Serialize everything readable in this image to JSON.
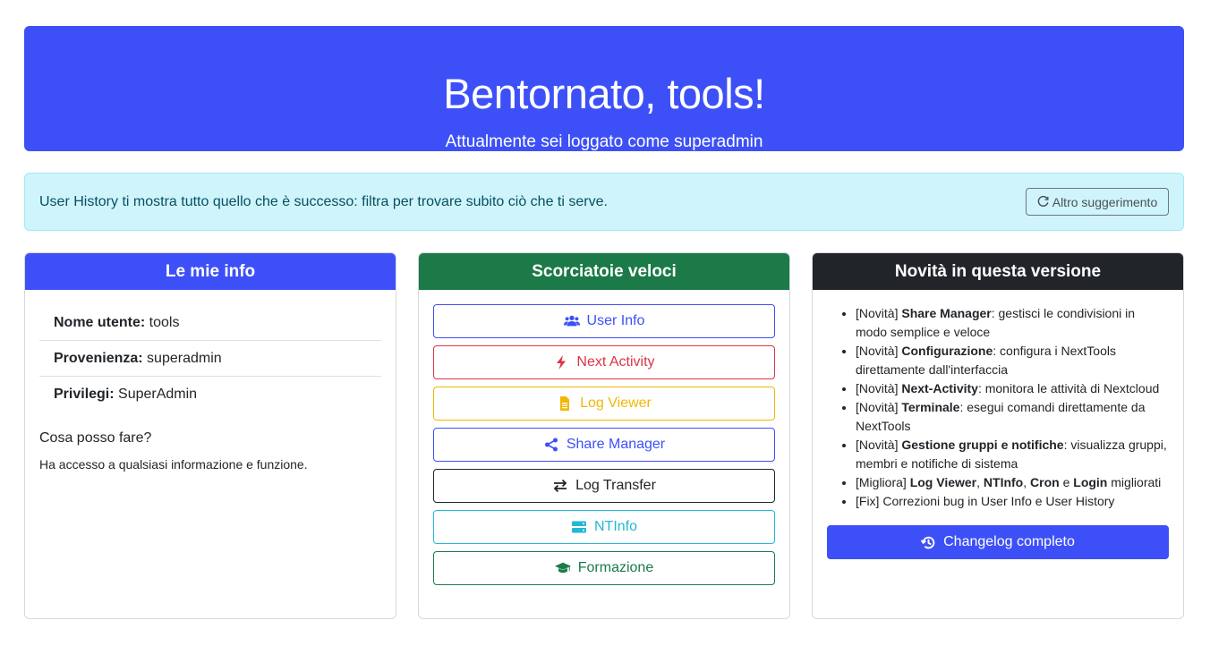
{
  "hero": {
    "title": "Bentornato, tools!",
    "subtitle_prefix": "Attualmente sei loggato come ",
    "subtitle_role": "superadmin"
  },
  "tip": {
    "text": "User History ti mostra tutto quello che è successo: filtra per trovare subito ciò che ti serve.",
    "button_label": "Altro suggerimento"
  },
  "info_card": {
    "title": "Le mie info",
    "rows": [
      {
        "label": "Nome utente:",
        "value": " tools"
      },
      {
        "label": "Provenienza:",
        "value": " superadmin"
      },
      {
        "label": "Privilegi:",
        "value": " SuperAdmin"
      }
    ],
    "can_title": "Cosa posso fare?",
    "can_text": "Ha accesso a qualsiasi informazione e funzione."
  },
  "shortcuts_card": {
    "title": "Scorciatoie veloci",
    "buttons": [
      {
        "label": "User Info",
        "icon": "users-icon",
        "color": "#3d50f8"
      },
      {
        "label": "Next Activity",
        "icon": "bolt-icon",
        "color": "#dc3545"
      },
      {
        "label": "Log Viewer",
        "icon": "file-icon",
        "color": "#f2b705"
      },
      {
        "label": "Share Manager",
        "icon": "share-icon",
        "color": "#3d50f8"
      },
      {
        "label": "Log Transfer",
        "icon": "exchange-icon",
        "color": "#212529"
      },
      {
        "label": "NTInfo",
        "icon": "server-icon",
        "color": "#22b8d6"
      },
      {
        "label": "Formazione",
        "icon": "graduation-cap-icon",
        "color": "#1b7a48"
      }
    ]
  },
  "news_card": {
    "title": "Novità in questa versione",
    "items": [
      {
        "tag": "[Novità] ",
        "bold": "Share Manager",
        "rest": ": gestisci le condivisioni in modo semplice e veloce"
      },
      {
        "tag": "[Novità] ",
        "bold": "Configurazione",
        "rest": ": configura i NextTools direttamente dall'interfaccia"
      },
      {
        "tag": "[Novità] ",
        "bold": "Next-Activity",
        "rest": ": monitora le attività di Nextcloud"
      },
      {
        "tag": "[Novità] ",
        "bold": "Terminale",
        "rest": ": esegui comandi direttamente da NextTools"
      },
      {
        "tag": "[Novità] ",
        "bold": "Gestione gruppi e notifiche",
        "rest": ": visualizza gruppi, membri e notifiche di sistema"
      },
      {
        "tag": "[Migliora] ",
        "b1": "Log Viewer",
        "s1": ", ",
        "b2": "NTInfo",
        "s2": ", ",
        "b3": "Cron",
        "s3": " e ",
        "b4": "Login",
        "s4": " migliorati"
      },
      {
        "tag": "[Fix] Correzioni bug in User Info e User History"
      }
    ],
    "button_label": "Changelog completo"
  },
  "colors": {
    "primary": "#3d50f8",
    "success": "#1b7a48",
    "dark": "#212529",
    "info_bg": "#cff4fc"
  }
}
